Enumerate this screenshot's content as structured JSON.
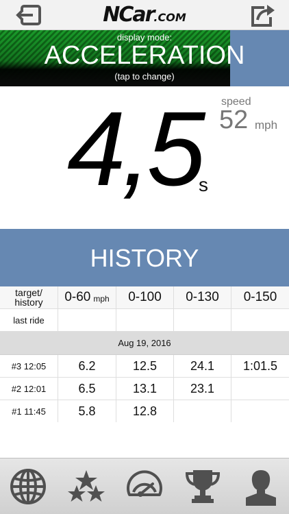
{
  "header": {
    "logo_main": "NCar",
    "logo_suffix": ".COM",
    "back_icon": "exit-arrow-icon",
    "share_icon": "share-icon"
  },
  "mode": {
    "caption": "display mode:",
    "title": "ACCELERATION",
    "hint": "(tap to change)",
    "stripe_color": "#1a9a2a",
    "side_color": "#6688b2"
  },
  "result": {
    "speed_label": "speed",
    "speed_value": "52",
    "speed_unit": "mph",
    "time_value": "4,5",
    "time_unit": "s"
  },
  "history": {
    "title": "HISTORY",
    "columns": {
      "label_line1": "target/",
      "label_line2": "history",
      "c1": "0-60",
      "c1_unit": "mph",
      "c2": "0-100",
      "c3": "0-130",
      "c4": "0-150"
    },
    "last_ride_label": "last ride",
    "date": "Aug 19, 2016",
    "rows": [
      {
        "label": "#3 12:05",
        "v1": "6.2",
        "v2": "12.5",
        "v3": "24.1",
        "v4": "1:01.5"
      },
      {
        "label": "#2 12:01",
        "v1": "6.5",
        "v2": "13.1",
        "v3": "23.1",
        "v4": ""
      },
      {
        "label": "#1 11:45",
        "v1": "5.8",
        "v2": "12.8",
        "v3": "",
        "v4": ""
      }
    ]
  },
  "tabs": [
    {
      "icon": "globe-icon"
    },
    {
      "icon": "stars-icon"
    },
    {
      "icon": "speedometer-icon"
    },
    {
      "icon": "trophy-icon"
    },
    {
      "icon": "profile-icon"
    }
  ]
}
